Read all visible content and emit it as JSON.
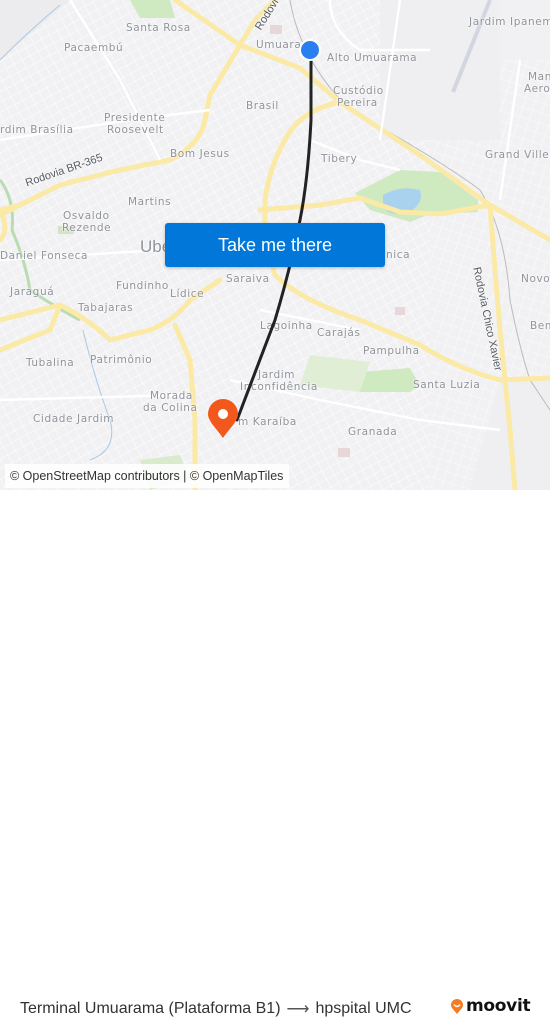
{
  "map": {
    "neighborhoods": [
      {
        "name": "Santa Rosa"
      },
      {
        "name": "Pacaembú"
      },
      {
        "name": "Umuara"
      },
      {
        "name": "Alto Umuarama"
      },
      {
        "name": "Jardim Ipanem"
      },
      {
        "name": "Custódio"
      },
      {
        "name": "Pereira"
      },
      {
        "name": "Brasil"
      },
      {
        "name": "Presidente"
      },
      {
        "name": "Roosevelt"
      },
      {
        "name": "rdim Brasília"
      },
      {
        "name": "Bom Jesus"
      },
      {
        "name": "Tibery"
      },
      {
        "name": "Grand Ville"
      },
      {
        "name": "Man"
      },
      {
        "name": "Aero"
      },
      {
        "name": "Martins"
      },
      {
        "name": "Osvaldo"
      },
      {
        "name": "Rezende"
      },
      {
        "name": "Ube"
      },
      {
        "name": "Daniel Fonseca"
      },
      {
        "name": "nica"
      },
      {
        "name": "Jaraguá"
      },
      {
        "name": "Fundinho"
      },
      {
        "name": "Lídice"
      },
      {
        "name": "Saraiva"
      },
      {
        "name": "Tabajaras"
      },
      {
        "name": "Novo"
      },
      {
        "name": "Lagoinha"
      },
      {
        "name": "Carajás"
      },
      {
        "name": "Bem"
      },
      {
        "name": "Pampulha"
      },
      {
        "name": "Tubalina"
      },
      {
        "name": "Patrimônio"
      },
      {
        "name": "Jardim"
      },
      {
        "name": "Inconfidência"
      },
      {
        "name": "Santa Luzia"
      },
      {
        "name": "Morada"
      },
      {
        "name": "da Colina"
      },
      {
        "name": "Cidade Jardim"
      },
      {
        "name": "m Karaíba"
      },
      {
        "name": "Granada"
      }
    ],
    "roads": {
      "rodovia_br365": "Rodovia BR-365",
      "rodovia_chico_xavier": "Rodovia Chico Xavier",
      "rodovia_top": "Rodovi"
    },
    "origin_marker": {
      "label": "Terminal Umuarama (Plataforma B1)",
      "color": "#2a7ff0"
    },
    "destination_marker": {
      "label": "hpspital UMC",
      "color": "#f2581c"
    },
    "route_color": "#222222",
    "attribution": "© OpenStreetMap contributors | © OpenMapTiles"
  },
  "cta": {
    "label": "Take me there",
    "color": "#0077d9"
  },
  "footer": {
    "origin": "Terminal Umuarama (Plataforma B1)",
    "arrow": "⟶",
    "destination": "hpspital UMC",
    "brand": "moovit",
    "brand_color": "#f47b20"
  }
}
